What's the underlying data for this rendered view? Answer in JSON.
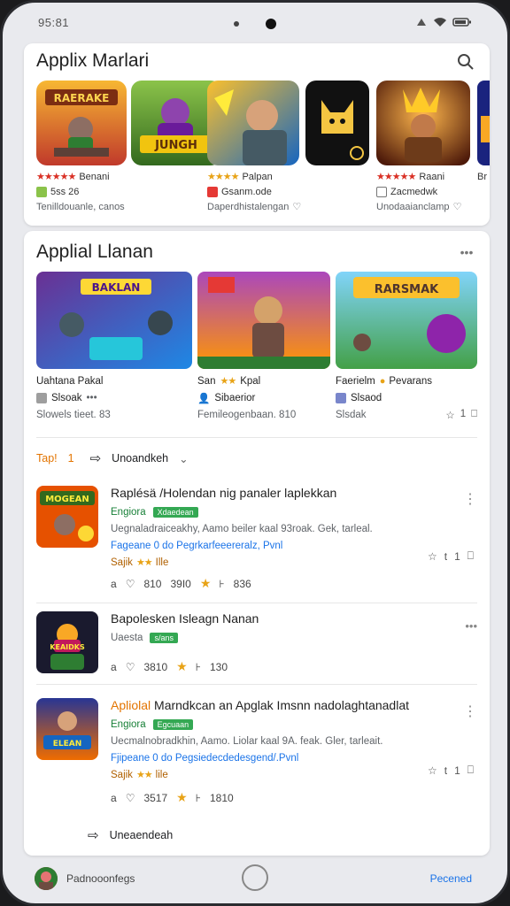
{
  "status": {
    "time": "95:81"
  },
  "top_section": {
    "title": "Applix Marlari",
    "apps": [
      {
        "art_text": "RAERAKE",
        "rating_label": "Benani",
        "info": "5ss 26",
        "desc": "Tenilldouanle, canos"
      },
      {
        "art_text": "JUNGH",
        "rating_label": "Palpan",
        "info": "Gsanm.ode",
        "desc": "Daperdhistalengan"
      },
      {
        "art_text": "",
        "rating_label": "",
        "info": "",
        "desc": ""
      },
      {
        "art_text": "",
        "rating_label": "Raani",
        "info": "Zacmedwk",
        "desc": "Unodaaianclamp"
      },
      {
        "art_text": "",
        "rating_label": "Br",
        "info": "",
        "desc": ""
      }
    ]
  },
  "featured_section": {
    "title": "Applial Llanan",
    "items": [
      {
        "art_text": "BAKLAN",
        "name": "Uahtana Pakal",
        "line2": "Slsoak",
        "line3": "Slowels tieet. 83"
      },
      {
        "art_text": "",
        "name": "San",
        "name_suffix": "Kpal",
        "line2": "Sibaerior",
        "line3": "Femileogenbaan. 810"
      },
      {
        "art_text": "RARSMAK",
        "name": "Faerielm",
        "name_suffix": "Pevarans",
        "line2": "Slsaod",
        "line3": "Slsdak",
        "count": "1"
      }
    ]
  },
  "filter_bar": {
    "label": "Tap!",
    "number": "1",
    "sort_label": "Unoandkeh"
  },
  "list": [
    {
      "art_text": "MOGEAN",
      "title": "Raplésä /Holendan nig panaler laplekkan",
      "category": "Engiora",
      "badge": "Xdaedean",
      "desc": "Uegnaladraiceakhy, Aamo beiler kaal 93roak. Gek, tarleal.",
      "link": "Fageane 0 do Pegrkarfeeereralz, Pvnl",
      "tag": "Sajik",
      "tag_after": "Ille",
      "stat1": "810",
      "prefix": "a",
      "stat2": "39I0",
      "stat3": "836",
      "side_count": "1",
      "side_plus": "t"
    },
    {
      "art_text": "KEAIDKS",
      "title": "Bapolesken Isleagn Nanan",
      "category": "Uaesta",
      "badge": "s/ans",
      "stat1": "a",
      "stat2": "3810",
      "stat3": "130"
    },
    {
      "art_text": "ELEAN",
      "title_accent": "Apliolal",
      "title": "Marndkcan an Apglak Imsnn nadolaghtanadlat",
      "category": "Engiora",
      "badge": "Egcuaan",
      "desc": "Uecmalnobradkhin, Aamo. Liolar kaal 9A. feak. Gler, tarleait.",
      "link": "Fjipeane 0 do Pegsiedecdedesgend/.Pvnl",
      "tag": "Sajik",
      "tag_after": "lile",
      "stat1": "a",
      "stat2": "3517",
      "stat3": "1810",
      "side_count": "1",
      "side_plus": "t"
    }
  ],
  "footer_link": "Uneaendeah",
  "bottom_bar": {
    "left_label": "Padnooonfegs",
    "right_label": "Pecened"
  }
}
